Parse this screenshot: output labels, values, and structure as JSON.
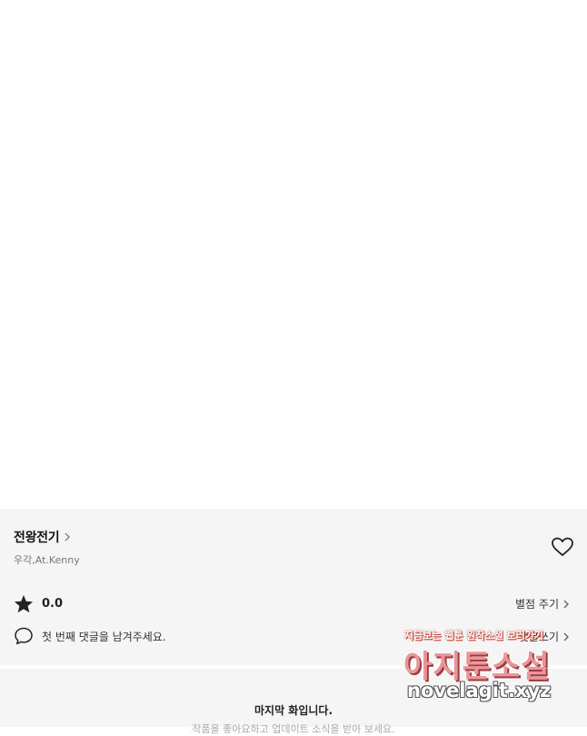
{
  "series": {
    "title": "전왕전기",
    "authors": "우각,At.Kenny"
  },
  "rating": {
    "value": "0.0",
    "rate_label": "별점 주기"
  },
  "comments": {
    "prompt": "첫 번째 댓글을 남겨주세요.",
    "write_label": "댓글쓰기"
  },
  "footer": {
    "last_episode": "마지막 화입니다.",
    "subtext": "작품을 좋아요하고 업데이트 소식을 받아 보세요."
  },
  "watermark": {
    "tagline": "지금보는 웹툰 원작소설 보러가기",
    "name": "아지툰소설",
    "url": "novelagit.xyz"
  },
  "colors": {
    "panel_bg": "#f5f5f5",
    "watermark_pink": "#e9969a"
  },
  "icons": {
    "star": "star-icon",
    "heart": "heart-icon",
    "comment": "speech-bubble-icon",
    "chevron": "chevron-right-icon"
  }
}
